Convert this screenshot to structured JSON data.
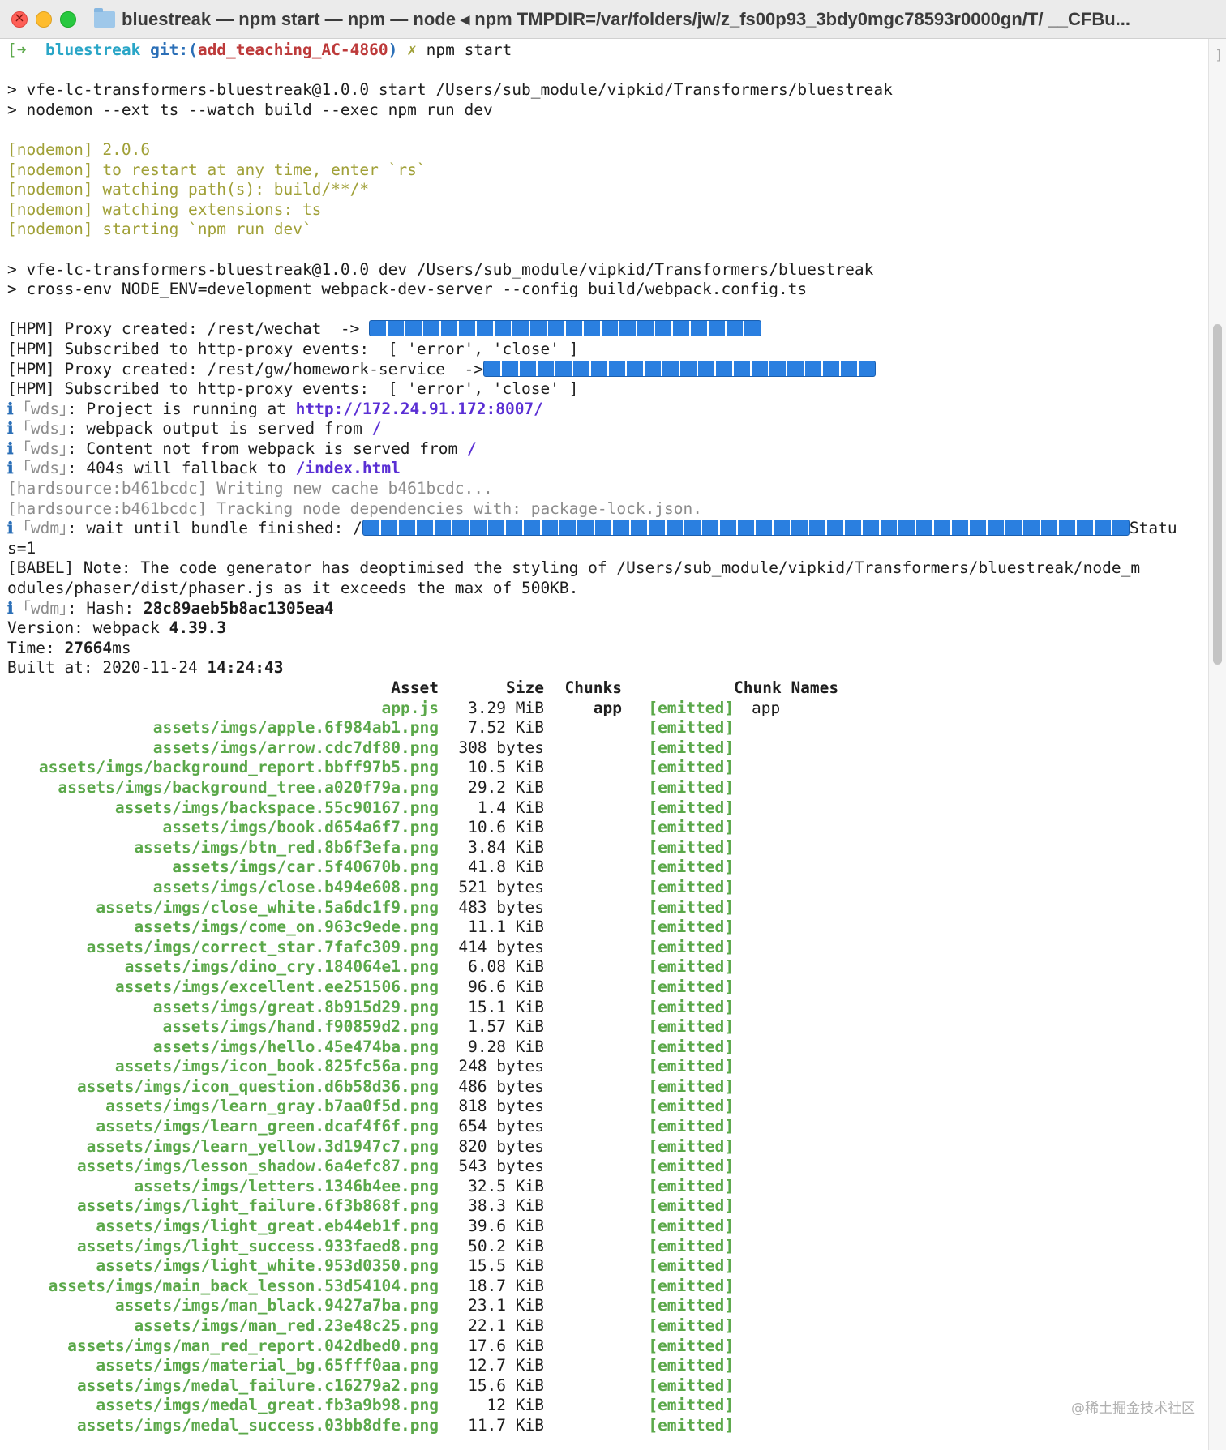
{
  "window": {
    "title": "bluestreak — npm start — npm — node ◂ npm TMPDIR=/var/folders/jw/z_fs00p93_3bdy0mgc78593r0000gn/T/ __CFBu..."
  },
  "prompt": {
    "arrow": "[➜",
    "dir": "bluestreak",
    "git_prefix": "git:(",
    "branch": "add_teaching_AC-4860",
    "git_suffix": ")",
    "dirty_mark": "✗",
    "command": "npm start"
  },
  "lines": {
    "start1": "> vfe-lc-transformers-bluestreak@1.0.0 start /Users/sub_module/vipkid/Transformers/bluestreak",
    "start2": "> nodemon --ext ts --watch build --exec npm run dev",
    "nodemon1": "[nodemon] 2.0.6",
    "nodemon2": "[nodemon] to restart at any time, enter `rs`",
    "nodemon3": "[nodemon] watching path(s): build/**/*",
    "nodemon4": "[nodemon] watching extensions: ts",
    "nodemon5": "[nodemon] starting `npm run dev`",
    "dev1": "> vfe-lc-transformers-bluestreak@1.0.0 dev /Users/sub_module/vipkid/Transformers/bluestreak",
    "dev2": "> cross-env NODE_ENV=development webpack-dev-server --config build/webpack.config.ts",
    "hpm1": "[HPM] Proxy created: /rest/wechat  -> ",
    "hpm2": "[HPM] Subscribed to http-proxy events:  [ 'error', 'close' ]",
    "hpm3": "[HPM] Proxy created: /rest/gw/homework-service  ->",
    "hpm4": "[HPM] Subscribed to http-proxy events:  [ 'error', 'close' ]",
    "info_icon": "ℹ",
    "wds_tag": "｢wds｣",
    "wdm_tag": "｢wdm｣",
    "wds1_text": ": Project is running at ",
    "wds1_url": "http://172.24.91.172:8007/",
    "wds2_text": ": webpack output is served from ",
    "wds2_path": "/",
    "wds3_text": ": Content not from webpack is served from ",
    "wds3_path": "/",
    "wds4_text": ": 404s will fallback to ",
    "wds4_path": "/index.html",
    "hs1": "[hardsource:b461bcdc] Writing new cache b461bcdc...",
    "hs2": "[hardsource:b461bcdc] Tracking node dependencies with: package-lock.json.",
    "wdm1_text": ": wait until bundle finished: /",
    "wdm1_tail": "Statu",
    "wdm1_wrap": "s=1",
    "babel1": "[BABEL] Note: The code generator has deoptimised the styling of /Users/sub_module/vipkid/Transformers/bluestreak/node_m",
    "babel2": "odules/phaser/dist/phaser.js as it exceeds the max of 500KB.",
    "hash_label": ": Hash: ",
    "hash_value": "28c89aeb5b8ac1305ea4",
    "version_label": "Version: webpack ",
    "version_value": "4.39.3",
    "time_label": "Time: ",
    "time_value": "27664",
    "time_unit": "ms",
    "built_label": "Built at: 2020-11-24 ",
    "built_time": "14:24:43"
  },
  "table": {
    "headers": {
      "asset": "Asset",
      "size": "Size",
      "chunks": "Chunks",
      "names": "Chunk Names"
    },
    "rows": [
      {
        "asset": "app.js",
        "size": "3.29 MiB",
        "chunks": "app",
        "status": "[emitted]",
        "names": "app"
      },
      {
        "asset": "assets/imgs/apple.6f984ab1.png",
        "size": "7.52 KiB",
        "chunks": "",
        "status": "[emitted]",
        "names": ""
      },
      {
        "asset": "assets/imgs/arrow.cdc7df80.png",
        "size": "308 bytes",
        "chunks": "",
        "status": "[emitted]",
        "names": ""
      },
      {
        "asset": "assets/imgs/background_report.bbff97b5.png",
        "size": "10.5 KiB",
        "chunks": "",
        "status": "[emitted]",
        "names": ""
      },
      {
        "asset": "assets/imgs/background_tree.a020f79a.png",
        "size": "29.2 KiB",
        "chunks": "",
        "status": "[emitted]",
        "names": ""
      },
      {
        "asset": "assets/imgs/backspace.55c90167.png",
        "size": "1.4 KiB",
        "chunks": "",
        "status": "[emitted]",
        "names": ""
      },
      {
        "asset": "assets/imgs/book.d654a6f7.png",
        "size": "10.6 KiB",
        "chunks": "",
        "status": "[emitted]",
        "names": ""
      },
      {
        "asset": "assets/imgs/btn_red.8b6f3efa.png",
        "size": "3.84 KiB",
        "chunks": "",
        "status": "[emitted]",
        "names": ""
      },
      {
        "asset": "assets/imgs/car.5f40670b.png",
        "size": "41.8 KiB",
        "chunks": "",
        "status": "[emitted]",
        "names": ""
      },
      {
        "asset": "assets/imgs/close.b494e608.png",
        "size": "521 bytes",
        "chunks": "",
        "status": "[emitted]",
        "names": ""
      },
      {
        "asset": "assets/imgs/close_white.5a6dc1f9.png",
        "size": "483 bytes",
        "chunks": "",
        "status": "[emitted]",
        "names": ""
      },
      {
        "asset": "assets/imgs/come_on.963c9ede.png",
        "size": "11.1 KiB",
        "chunks": "",
        "status": "[emitted]",
        "names": ""
      },
      {
        "asset": "assets/imgs/correct_star.7fafc309.png",
        "size": "414 bytes",
        "chunks": "",
        "status": "[emitted]",
        "names": ""
      },
      {
        "asset": "assets/imgs/dino_cry.184064e1.png",
        "size": "6.08 KiB",
        "chunks": "",
        "status": "[emitted]",
        "names": ""
      },
      {
        "asset": "assets/imgs/excellent.ee251506.png",
        "size": "96.6 KiB",
        "chunks": "",
        "status": "[emitted]",
        "names": ""
      },
      {
        "asset": "assets/imgs/great.8b915d29.png",
        "size": "15.1 KiB",
        "chunks": "",
        "status": "[emitted]",
        "names": ""
      },
      {
        "asset": "assets/imgs/hand.f90859d2.png",
        "size": "1.57 KiB",
        "chunks": "",
        "status": "[emitted]",
        "names": ""
      },
      {
        "asset": "assets/imgs/hello.45e474ba.png",
        "size": "9.28 KiB",
        "chunks": "",
        "status": "[emitted]",
        "names": ""
      },
      {
        "asset": "assets/imgs/icon_book.825fc56a.png",
        "size": "248 bytes",
        "chunks": "",
        "status": "[emitted]",
        "names": ""
      },
      {
        "asset": "assets/imgs/icon_question.d6b58d36.png",
        "size": "486 bytes",
        "chunks": "",
        "status": "[emitted]",
        "names": ""
      },
      {
        "asset": "assets/imgs/learn_gray.b7aa0f5d.png",
        "size": "818 bytes",
        "chunks": "",
        "status": "[emitted]",
        "names": ""
      },
      {
        "asset": "assets/imgs/learn_green.dcaf4f6f.png",
        "size": "654 bytes",
        "chunks": "",
        "status": "[emitted]",
        "names": ""
      },
      {
        "asset": "assets/imgs/learn_yellow.3d1947c7.png",
        "size": "820 bytes",
        "chunks": "",
        "status": "[emitted]",
        "names": ""
      },
      {
        "asset": "assets/imgs/lesson_shadow.6a4efc87.png",
        "size": "543 bytes",
        "chunks": "",
        "status": "[emitted]",
        "names": ""
      },
      {
        "asset": "assets/imgs/letters.1346b4ee.png",
        "size": "32.5 KiB",
        "chunks": "",
        "status": "[emitted]",
        "names": ""
      },
      {
        "asset": "assets/imgs/light_failure.6f3b868f.png",
        "size": "38.3 KiB",
        "chunks": "",
        "status": "[emitted]",
        "names": ""
      },
      {
        "asset": "assets/imgs/light_great.eb44eb1f.png",
        "size": "39.6 KiB",
        "chunks": "",
        "status": "[emitted]",
        "names": ""
      },
      {
        "asset": "assets/imgs/light_success.933faed8.png",
        "size": "50.2 KiB",
        "chunks": "",
        "status": "[emitted]",
        "names": ""
      },
      {
        "asset": "assets/imgs/light_white.953d0350.png",
        "size": "15.5 KiB",
        "chunks": "",
        "status": "[emitted]",
        "names": ""
      },
      {
        "asset": "assets/imgs/main_back_lesson.53d54104.png",
        "size": "18.7 KiB",
        "chunks": "",
        "status": "[emitted]",
        "names": ""
      },
      {
        "asset": "assets/imgs/man_black.9427a7ba.png",
        "size": "23.1 KiB",
        "chunks": "",
        "status": "[emitted]",
        "names": ""
      },
      {
        "asset": "assets/imgs/man_red.23e48c25.png",
        "size": "22.1 KiB",
        "chunks": "",
        "status": "[emitted]",
        "names": ""
      },
      {
        "asset": "assets/imgs/man_red_report.042dbed0.png",
        "size": "17.6 KiB",
        "chunks": "",
        "status": "[emitted]",
        "names": ""
      },
      {
        "asset": "assets/imgs/material_bg.65fff0aa.png",
        "size": "12.7 KiB",
        "chunks": "",
        "status": "[emitted]",
        "names": ""
      },
      {
        "asset": "assets/imgs/medal_failure.c16279a2.png",
        "size": "15.6 KiB",
        "chunks": "",
        "status": "[emitted]",
        "names": ""
      },
      {
        "asset": "assets/imgs/medal_great.fb3a9b98.png",
        "size": "12 KiB",
        "chunks": "",
        "status": "[emitted]",
        "names": ""
      },
      {
        "asset": "assets/imgs/medal_success.03bb8dfe.png",
        "size": "11.7 KiB",
        "chunks": "",
        "status": "[emitted]",
        "names": ""
      }
    ]
  },
  "watermark": "@稀土掘金技术社区",
  "scroll_edge": "]",
  "colors": {
    "asset_green": "#5ba84a",
    "nodemon_yellow": "#a0a037",
    "branch_red": "#bd3a3a",
    "dir_cyan": "#2aa6c7",
    "url_purple": "#5a2fd4",
    "replacement_glyph_blue": "#2a7fe0"
  }
}
